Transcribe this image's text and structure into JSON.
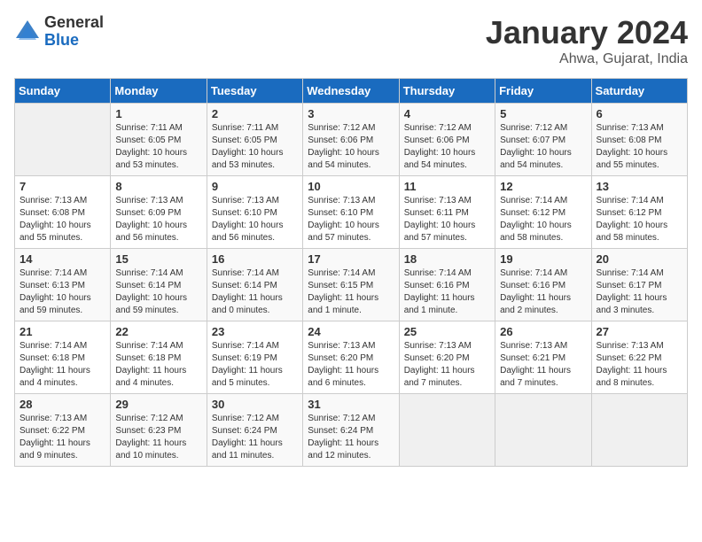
{
  "header": {
    "logo_general": "General",
    "logo_blue": "Blue",
    "title": "January 2024",
    "subtitle": "Ahwa, Gujarat, India"
  },
  "columns": [
    "Sunday",
    "Monday",
    "Tuesday",
    "Wednesday",
    "Thursday",
    "Friday",
    "Saturday"
  ],
  "weeks": [
    [
      {
        "day": "",
        "sunrise": "",
        "sunset": "",
        "daylight": ""
      },
      {
        "day": "1",
        "sunrise": "Sunrise: 7:11 AM",
        "sunset": "Sunset: 6:05 PM",
        "daylight": "Daylight: 10 hours and 53 minutes."
      },
      {
        "day": "2",
        "sunrise": "Sunrise: 7:11 AM",
        "sunset": "Sunset: 6:05 PM",
        "daylight": "Daylight: 10 hours and 53 minutes."
      },
      {
        "day": "3",
        "sunrise": "Sunrise: 7:12 AM",
        "sunset": "Sunset: 6:06 PM",
        "daylight": "Daylight: 10 hours and 54 minutes."
      },
      {
        "day": "4",
        "sunrise": "Sunrise: 7:12 AM",
        "sunset": "Sunset: 6:06 PM",
        "daylight": "Daylight: 10 hours and 54 minutes."
      },
      {
        "day": "5",
        "sunrise": "Sunrise: 7:12 AM",
        "sunset": "Sunset: 6:07 PM",
        "daylight": "Daylight: 10 hours and 54 minutes."
      },
      {
        "day": "6",
        "sunrise": "Sunrise: 7:13 AM",
        "sunset": "Sunset: 6:08 PM",
        "daylight": "Daylight: 10 hours and 55 minutes."
      }
    ],
    [
      {
        "day": "7",
        "sunrise": "Sunrise: 7:13 AM",
        "sunset": "Sunset: 6:08 PM",
        "daylight": "Daylight: 10 hours and 55 minutes."
      },
      {
        "day": "8",
        "sunrise": "Sunrise: 7:13 AM",
        "sunset": "Sunset: 6:09 PM",
        "daylight": "Daylight: 10 hours and 56 minutes."
      },
      {
        "day": "9",
        "sunrise": "Sunrise: 7:13 AM",
        "sunset": "Sunset: 6:10 PM",
        "daylight": "Daylight: 10 hours and 56 minutes."
      },
      {
        "day": "10",
        "sunrise": "Sunrise: 7:13 AM",
        "sunset": "Sunset: 6:10 PM",
        "daylight": "Daylight: 10 hours and 57 minutes."
      },
      {
        "day": "11",
        "sunrise": "Sunrise: 7:13 AM",
        "sunset": "Sunset: 6:11 PM",
        "daylight": "Daylight: 10 hours and 57 minutes."
      },
      {
        "day": "12",
        "sunrise": "Sunrise: 7:14 AM",
        "sunset": "Sunset: 6:12 PM",
        "daylight": "Daylight: 10 hours and 58 minutes."
      },
      {
        "day": "13",
        "sunrise": "Sunrise: 7:14 AM",
        "sunset": "Sunset: 6:12 PM",
        "daylight": "Daylight: 10 hours and 58 minutes."
      }
    ],
    [
      {
        "day": "14",
        "sunrise": "Sunrise: 7:14 AM",
        "sunset": "Sunset: 6:13 PM",
        "daylight": "Daylight: 10 hours and 59 minutes."
      },
      {
        "day": "15",
        "sunrise": "Sunrise: 7:14 AM",
        "sunset": "Sunset: 6:14 PM",
        "daylight": "Daylight: 10 hours and 59 minutes."
      },
      {
        "day": "16",
        "sunrise": "Sunrise: 7:14 AM",
        "sunset": "Sunset: 6:14 PM",
        "daylight": "Daylight: 11 hours and 0 minutes."
      },
      {
        "day": "17",
        "sunrise": "Sunrise: 7:14 AM",
        "sunset": "Sunset: 6:15 PM",
        "daylight": "Daylight: 11 hours and 1 minute."
      },
      {
        "day": "18",
        "sunrise": "Sunrise: 7:14 AM",
        "sunset": "Sunset: 6:16 PM",
        "daylight": "Daylight: 11 hours and 1 minute."
      },
      {
        "day": "19",
        "sunrise": "Sunrise: 7:14 AM",
        "sunset": "Sunset: 6:16 PM",
        "daylight": "Daylight: 11 hours and 2 minutes."
      },
      {
        "day": "20",
        "sunrise": "Sunrise: 7:14 AM",
        "sunset": "Sunset: 6:17 PM",
        "daylight": "Daylight: 11 hours and 3 minutes."
      }
    ],
    [
      {
        "day": "21",
        "sunrise": "Sunrise: 7:14 AM",
        "sunset": "Sunset: 6:18 PM",
        "daylight": "Daylight: 11 hours and 4 minutes."
      },
      {
        "day": "22",
        "sunrise": "Sunrise: 7:14 AM",
        "sunset": "Sunset: 6:18 PM",
        "daylight": "Daylight: 11 hours and 4 minutes."
      },
      {
        "day": "23",
        "sunrise": "Sunrise: 7:14 AM",
        "sunset": "Sunset: 6:19 PM",
        "daylight": "Daylight: 11 hours and 5 minutes."
      },
      {
        "day": "24",
        "sunrise": "Sunrise: 7:13 AM",
        "sunset": "Sunset: 6:20 PM",
        "daylight": "Daylight: 11 hours and 6 minutes."
      },
      {
        "day": "25",
        "sunrise": "Sunrise: 7:13 AM",
        "sunset": "Sunset: 6:20 PM",
        "daylight": "Daylight: 11 hours and 7 minutes."
      },
      {
        "day": "26",
        "sunrise": "Sunrise: 7:13 AM",
        "sunset": "Sunset: 6:21 PM",
        "daylight": "Daylight: 11 hours and 7 minutes."
      },
      {
        "day": "27",
        "sunrise": "Sunrise: 7:13 AM",
        "sunset": "Sunset: 6:22 PM",
        "daylight": "Daylight: 11 hours and 8 minutes."
      }
    ],
    [
      {
        "day": "28",
        "sunrise": "Sunrise: 7:13 AM",
        "sunset": "Sunset: 6:22 PM",
        "daylight": "Daylight: 11 hours and 9 minutes."
      },
      {
        "day": "29",
        "sunrise": "Sunrise: 7:12 AM",
        "sunset": "Sunset: 6:23 PM",
        "daylight": "Daylight: 11 hours and 10 minutes."
      },
      {
        "day": "30",
        "sunrise": "Sunrise: 7:12 AM",
        "sunset": "Sunset: 6:24 PM",
        "daylight": "Daylight: 11 hours and 11 minutes."
      },
      {
        "day": "31",
        "sunrise": "Sunrise: 7:12 AM",
        "sunset": "Sunset: 6:24 PM",
        "daylight": "Daylight: 11 hours and 12 minutes."
      },
      {
        "day": "",
        "sunrise": "",
        "sunset": "",
        "daylight": ""
      },
      {
        "day": "",
        "sunrise": "",
        "sunset": "",
        "daylight": ""
      },
      {
        "day": "",
        "sunrise": "",
        "sunset": "",
        "daylight": ""
      }
    ]
  ]
}
